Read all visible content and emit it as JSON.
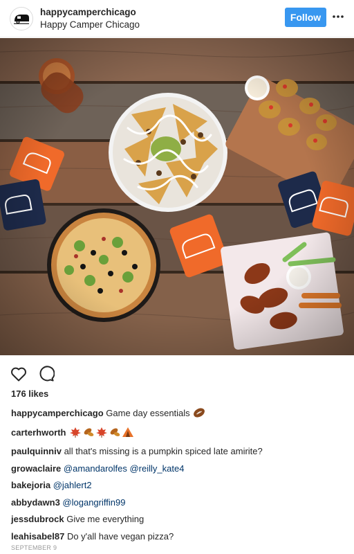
{
  "header": {
    "username": "happycamperchicago",
    "location": "Happy Camper Chicago",
    "follow_label": "Follow",
    "more_icon": "more-options-icon"
  },
  "actions": {
    "like_icon": "heart-icon",
    "comment_icon": "comment-icon"
  },
  "likes": "176 likes",
  "caption": {
    "user": "happycamperchicago",
    "text": "Game day essentials",
    "emoji": "football-emoji"
  },
  "comments": [
    {
      "user": "carterhworth",
      "text": "",
      "emoji": "leaves-and-tent-emojis"
    },
    {
      "user": "paulquinniv",
      "text": "all that's missing is a pumpkin spiced late amirite?"
    },
    {
      "user": "growaclaire",
      "mentions": [
        "@amandarolfes",
        "@reilly_kate4"
      ]
    },
    {
      "user": "bakejoria",
      "mentions": [
        "@jahlert2"
      ]
    },
    {
      "user": "abbydawn3",
      "mentions": [
        "@logangriffin99"
      ]
    },
    {
      "user": "jessdubrock",
      "text": "Give me everything"
    },
    {
      "user": "leahisabel87",
      "text": "Do y'all have vegan pizza?"
    }
  ],
  "timestamp": "SEPTEMBER 9",
  "colors": {
    "follow_button": "#3897f0",
    "mention": "#003569",
    "koozie_orange": "#f06a2a",
    "koozie_navy": "#1d2a4a"
  }
}
